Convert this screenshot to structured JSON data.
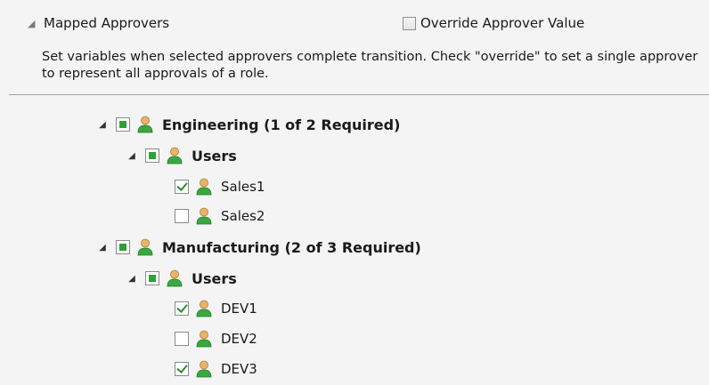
{
  "section": {
    "title": "Mapped Approvers",
    "toggle_glyph": "◢",
    "override_label": "Override Approver Value",
    "override_checked": false,
    "description": "Set variables when selected approvers complete transition. Check \"override\" to set a single approver to represent all approvals of a role."
  },
  "tree": {
    "expander_glyph": "◢",
    "nodes": [
      {
        "label": "Engineering (1 of 2 Required)",
        "state": "partial",
        "bold": true,
        "expandable": true,
        "icon": "user-icon"
      },
      {
        "label": "Users",
        "state": "partial",
        "bold": true,
        "expandable": true,
        "icon": "user-icon"
      },
      {
        "label": "Sales1",
        "state": "checked",
        "bold": false,
        "expandable": false,
        "icon": "user-icon"
      },
      {
        "label": "Sales2",
        "state": "unchecked",
        "bold": false,
        "expandable": false,
        "icon": "user-icon"
      },
      {
        "label": "Manufacturing (2 of 3 Required)",
        "state": "partial",
        "bold": true,
        "expandable": true,
        "icon": "user-icon"
      },
      {
        "label": "Users",
        "state": "partial",
        "bold": true,
        "expandable": true,
        "icon": "user-icon"
      },
      {
        "label": "DEV1",
        "state": "checked",
        "bold": false,
        "expandable": false,
        "icon": "user-icon"
      },
      {
        "label": "DEV2",
        "state": "unchecked",
        "bold": false,
        "expandable": false,
        "icon": "user-icon"
      },
      {
        "label": "DEV3",
        "state": "checked",
        "bold": false,
        "expandable": false,
        "icon": "user-icon"
      }
    ]
  },
  "colors": {
    "background": "#f4f4f4",
    "check_green": "#2f8e3a",
    "partial_green": "#2ea03a",
    "user_head": "#e8b36a",
    "user_body": "#3aa83e"
  }
}
